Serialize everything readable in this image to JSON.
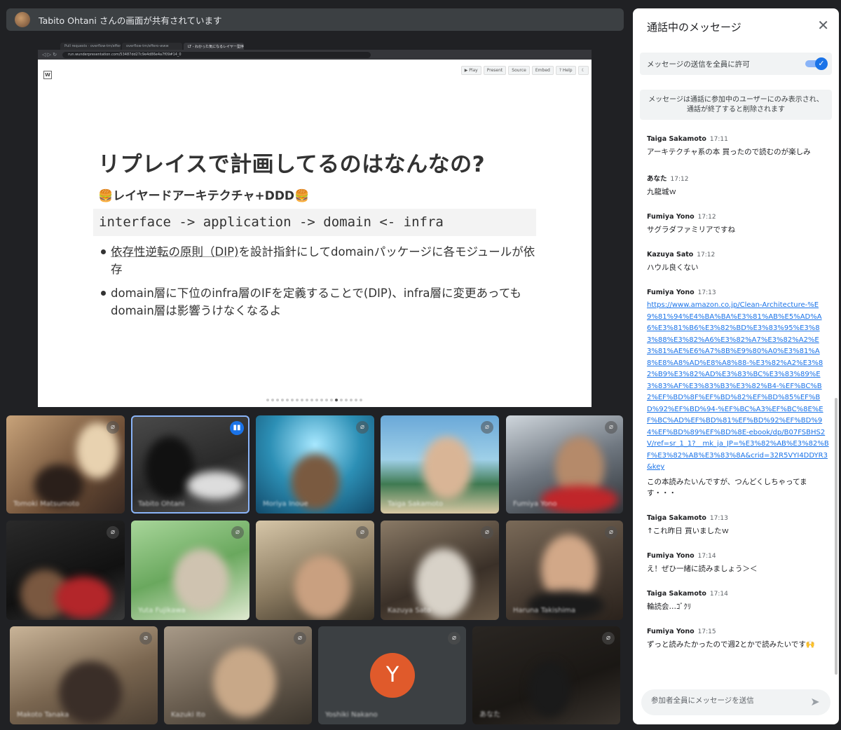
{
  "banner": {
    "text": "Tabito Ohtani さんの画面が共有されています"
  },
  "browser": {
    "tabs": [
      "Pull requests · overflow-tm/effero-",
      "overflow-tm/effero-www",
      "LT - わかった気になるレイヤー型序..."
    ],
    "url": "run.wunderpresentation.com/53487dd27c9e4d86e4a7f09#14_0"
  },
  "slide": {
    "logo": "W",
    "toolbar": [
      "▶ Play",
      "Present",
      "Source",
      "Embed",
      "? Help",
      "☾"
    ],
    "title": "リプレイスで計画してるのはなんなの?",
    "subtitle": "🍔レイヤードアーキテクチャ+DDD🍔",
    "code": "interface -> application -> domain <- infra",
    "bullet1_link": "依存性逆転の原則（DIP)",
    "bullet1_rest": "を設計指針にしてdomainパッケージに各モジュールが依存",
    "bullet2": "domain層に下位のinfra層のIFを定義することで(DIP)、infra層に変更あってもdomain層は影響うけなくなるよ",
    "page_count": 20,
    "current_page": 15
  },
  "participants": [
    {
      "name": "Tomoki Matsumoto"
    },
    {
      "name": "Tabito Ohtani"
    },
    {
      "name": "Moriya Inoue"
    },
    {
      "name": "Taiga Sakamoto"
    },
    {
      "name": "Fumiya Yono"
    },
    {
      "name": ""
    },
    {
      "name": "Yuta Fujikawa"
    },
    {
      "name": ""
    },
    {
      "name": "Kazuya Sato"
    },
    {
      "name": "Haruna Takishima"
    },
    {
      "name": "Makoto Tanaka"
    },
    {
      "name": "Kazuki Ito"
    },
    {
      "name": "Yoshiki Nakano",
      "initial": "Y"
    },
    {
      "name": "あなた"
    }
  ],
  "chat": {
    "title": "通話中のメッセージ",
    "permission_label": "メッセージの送信を全員に許可",
    "info": "メッセージは通話に参加中のユーザーにのみ表示され、通話が終了すると削除されます",
    "messages": [
      {
        "sender": "Taiga Sakamoto",
        "time": "17:11",
        "text": "アーキテクチャ系の本 買ったので読むのが楽しみ"
      },
      {
        "sender": "あなた",
        "time": "17:12",
        "text": "九龍城ｗ"
      },
      {
        "sender": "Fumiya Yono",
        "time": "17:12",
        "text": "サグラダファミリアですね"
      },
      {
        "sender": "Kazuya Sato",
        "time": "17:12",
        "text": "ハウル良くない"
      },
      {
        "sender": "Fumiya Yono",
        "time": "17:13",
        "link": "https://www.amazon.co.jp/Clean-Architecture-%E9%81%94%E4%BA%BA%E3%81%AB%E5%AD%A6%E3%81%B6%E3%82%BD%E3%83%95%E3%83%88%E3%82%A6%E3%82%A7%E3%82%A2%E3%81%AE%E6%A7%8B%E9%80%A0%E3%81%A8%E8%A8%AD%E8%A8%88-%E3%82%A2%E3%82%B9%E3%82%AD%E3%83%BC%E3%83%89%E3%83%AF%E3%83%B3%E3%82%B4-%EF%BC%B2%EF%BD%8F%EF%BD%82%EF%BD%85%EF%BD%92%EF%BD%94-%EF%BC%A3%EF%BC%8E%EF%BC%AD%EF%BD%81%EF%BD%92%EF%BD%94%EF%BD%89%EF%BD%8E-ebook/dp/B07FSBHS2V/ref=sr_1_1?__mk_ja_JP=%E3%82%AB%E3%82%BF%E3%82%AB%E3%83%8A&crid=32R5VYI4DDYR3&key",
        "text": "この本読みたいんですが、つんどくしちゃってます・・・"
      },
      {
        "sender": "Taiga Sakamoto",
        "time": "17:13",
        "text": "↑これ昨日 買いましたｗ"
      },
      {
        "sender": "Fumiya Yono",
        "time": "17:14",
        "text": "え！ぜひ一緒に読みましょう＞＜"
      },
      {
        "sender": "Taiga Sakamoto",
        "time": "17:14",
        "text": "輪読会…ｺﾞｸﾘ"
      },
      {
        "sender": "Fumiya Yono",
        "time": "17:15",
        "text": "ずっと読みたかったので週2とかで読みたいです🙌"
      }
    ],
    "composer_placeholder": "参加者全員にメッセージを送信"
  },
  "colors": {
    "accent": "#1a73e8",
    "bg": "#202124",
    "tile_border": "#8ab4f8",
    "avatar_y": "#e05a2b"
  },
  "icons": {
    "close": "close-icon",
    "send": "send-icon",
    "mic_off": "mic-off-icon",
    "check": "check-icon"
  }
}
